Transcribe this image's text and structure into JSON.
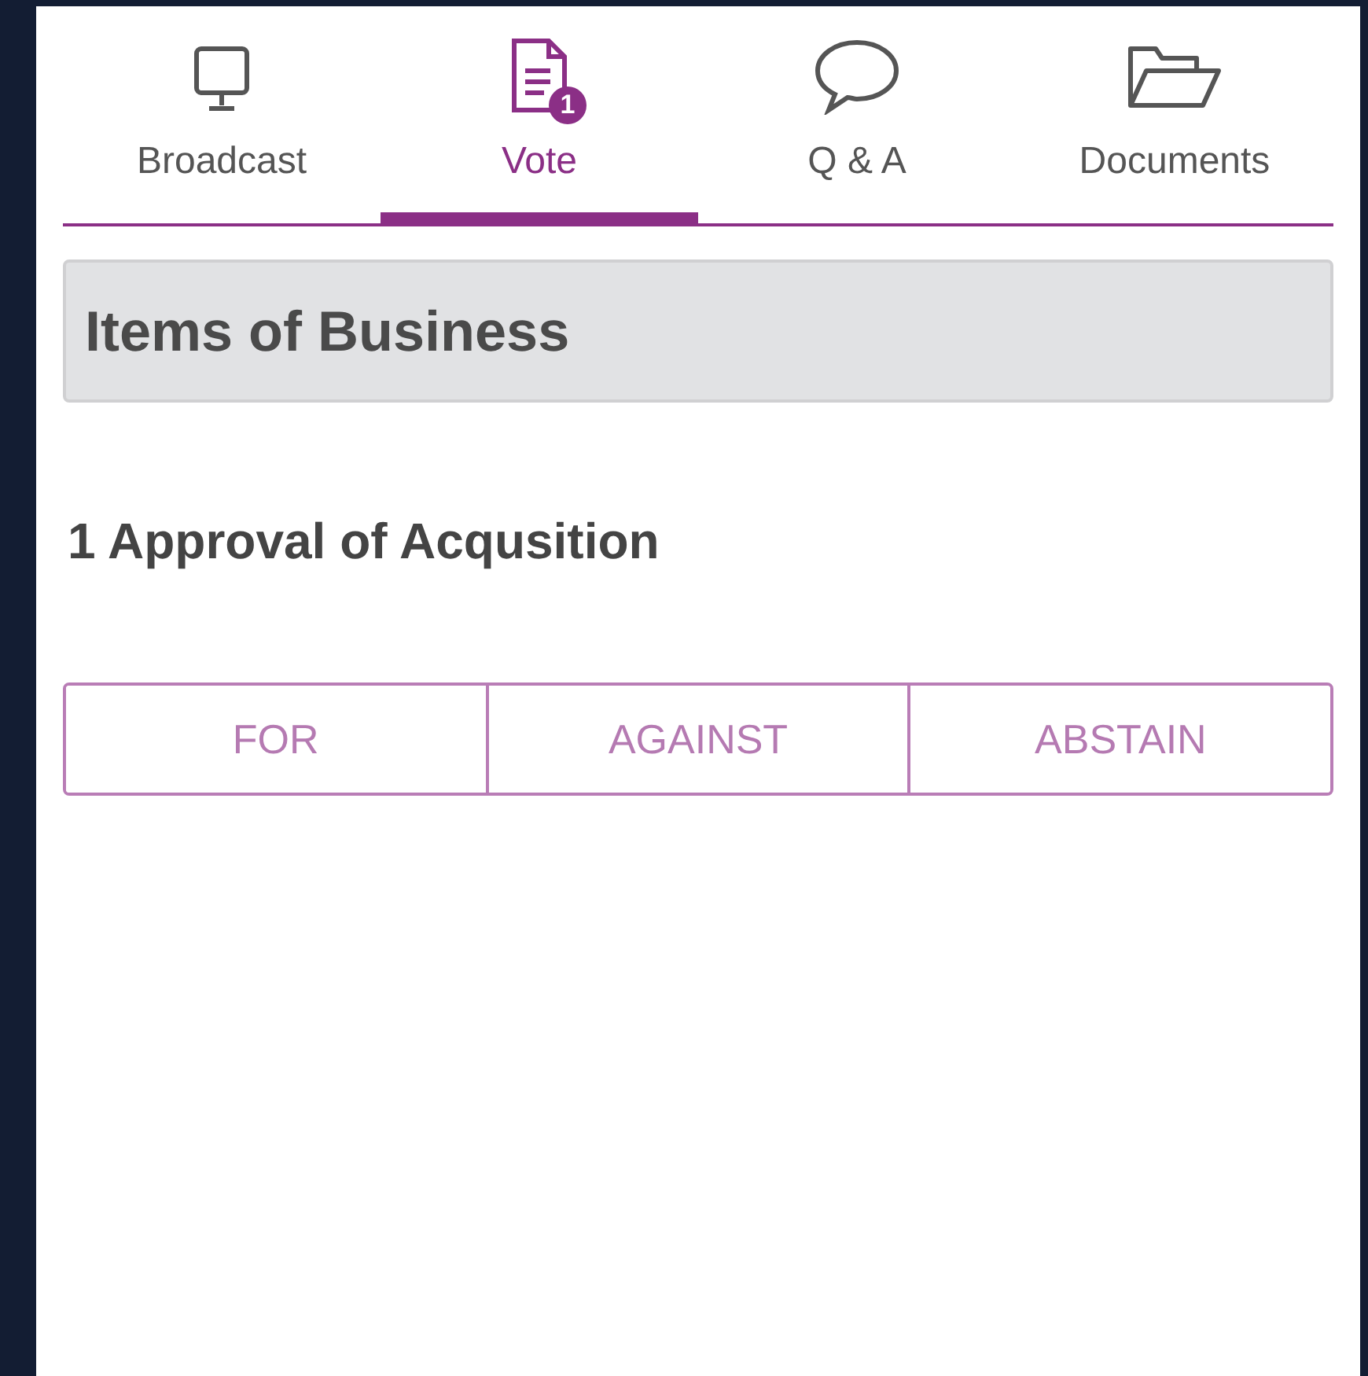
{
  "tabs": [
    {
      "label": "Broadcast",
      "selected": false
    },
    {
      "label": "Vote",
      "selected": true,
      "badge": "1"
    },
    {
      "label": "Q & A",
      "selected": false
    },
    {
      "label": "Documents",
      "selected": false
    }
  ],
  "section": {
    "title": "Items of Business"
  },
  "item": {
    "title": "1 Approval of Acqusition"
  },
  "vote_options": [
    {
      "label": "FOR",
      "selected": false
    },
    {
      "label": "AGAINST",
      "selected": false
    },
    {
      "label": "ABSTAIN",
      "selected": false
    }
  ]
}
